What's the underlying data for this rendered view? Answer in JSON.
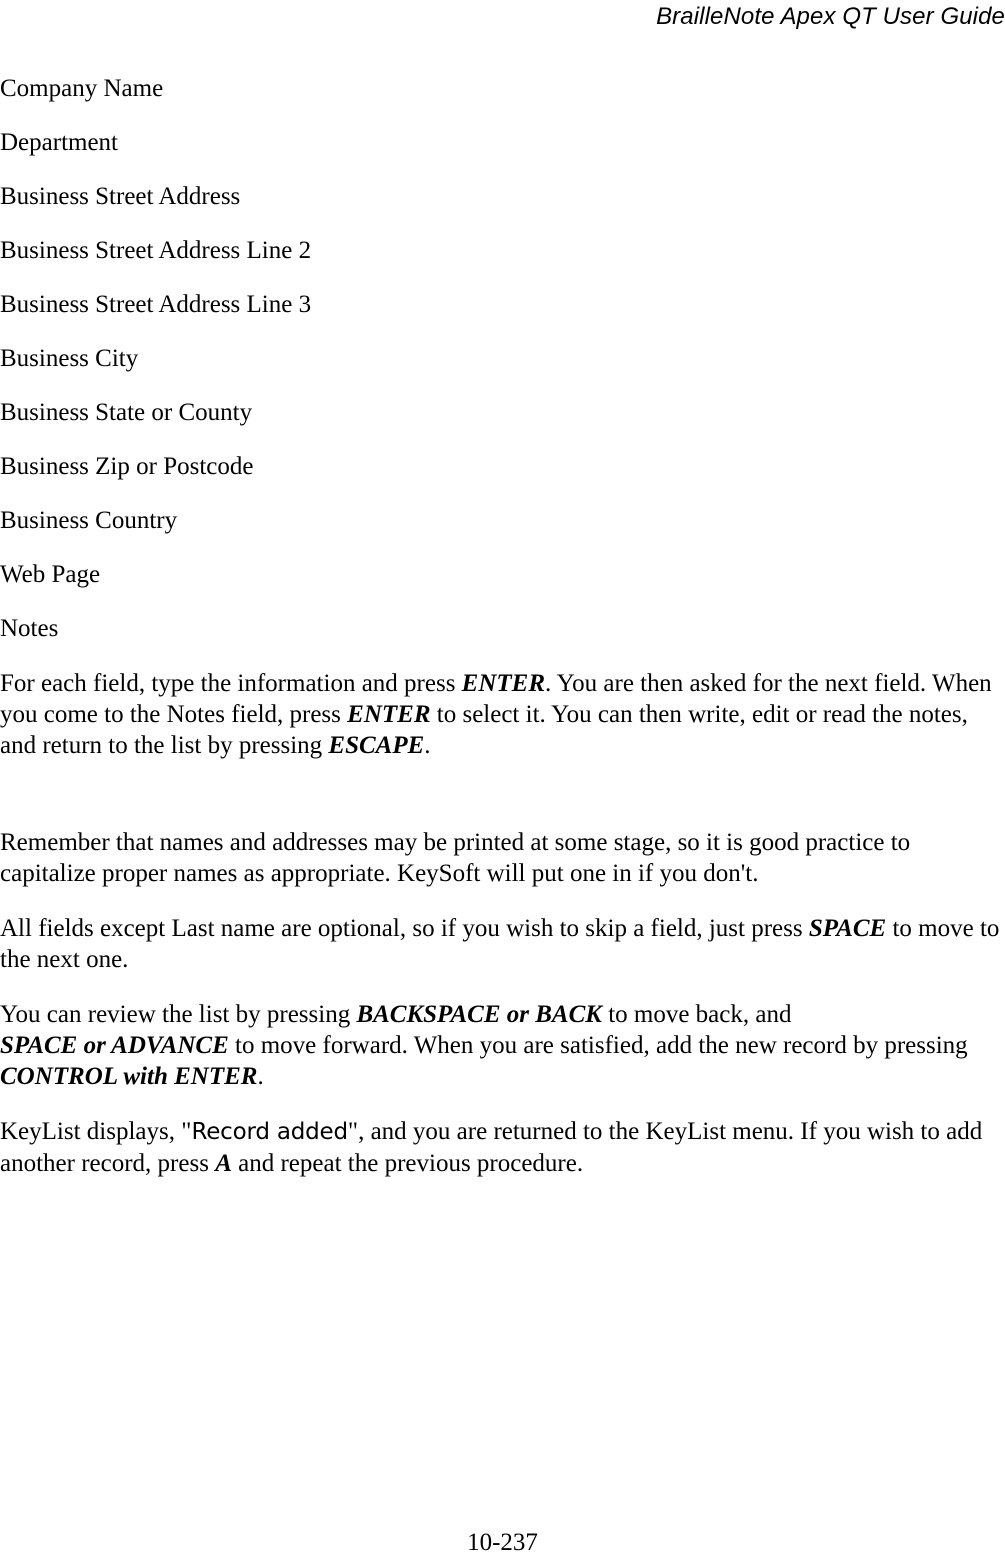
{
  "header": {
    "title": "BrailleNote Apex QT User Guide"
  },
  "fields": [
    {
      "label": "Company Name"
    },
    {
      "label": "Department"
    },
    {
      "label": "Business Street Address"
    },
    {
      "label": "Business Street Address Line 2"
    },
    {
      "label": "Business Street Address Line 3"
    },
    {
      "label": "Business City"
    },
    {
      "label": "Business State or County"
    },
    {
      "label": "Business Zip or Postcode"
    },
    {
      "label": "Business Country"
    },
    {
      "label": "Web Page"
    },
    {
      "label": "Notes"
    }
  ],
  "paragraphs": {
    "p1": {
      "seg1": "For each field, type the information and press ",
      "key1": "ENTER",
      "seg2": ". You are then asked for the next field. When you come to the Notes field, press ",
      "key2": "ENTER",
      "seg3": " to select it. You can then write, edit or read the notes, and return to the list by pressing ",
      "key3": "ESCAPE",
      "seg4": "."
    },
    "p2": {
      "seg1": "Remember that names and addresses may be printed at some stage, so it is good practice to capitalize proper names as appropriate. KeySoft will put one in if you don't."
    },
    "p3": {
      "seg1": "All fields except Last name are optional, so if you wish to skip a field, just press ",
      "key1": "SPACE",
      "seg2": " to move to the next one."
    },
    "p4": {
      "seg1": "You can review the list by pressing ",
      "key1": "BACKSPACE or BACK",
      "seg2": " to move back, and ",
      "key2": "SPACE or ADVANCE",
      "seg3": " to move forward. When you are satisfied, add the new record by pressing ",
      "key3": "CONTROL with ENTER",
      "seg4": "."
    },
    "p5": {
      "seg1": "KeyList displays, \"",
      "display1": "Record added",
      "seg2": "\", and you are returned to the KeyList menu. If you wish to add another record, press ",
      "key1": "A",
      "seg3": " and repeat the previous procedure."
    }
  },
  "footer": {
    "page_number": "10-237"
  }
}
